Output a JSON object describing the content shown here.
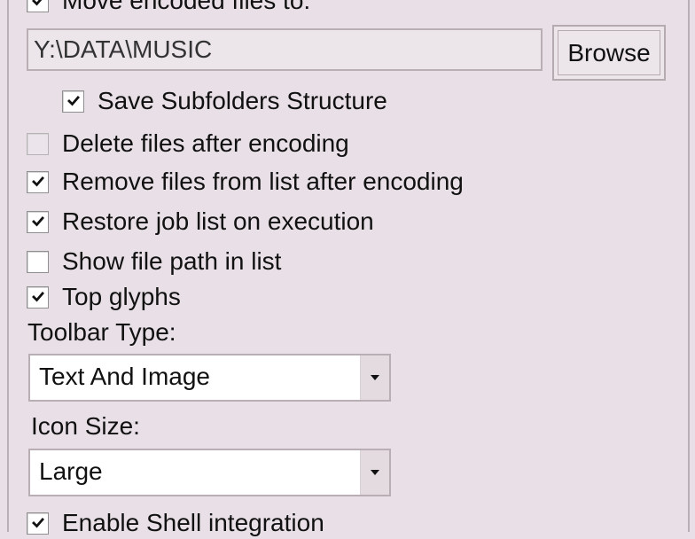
{
  "options": {
    "move_encoded_label": "Move encoded files to:",
    "move_encoded_path": "Y:\\DATA\\MUSIC",
    "browse_label": "Browse",
    "save_subfolders_label": "Save Subfolders Structure",
    "delete_files_label": "Delete files after encoding",
    "remove_files_label": "Remove files from list after encoding",
    "restore_job_list_label": "Restore job list on execution",
    "show_file_path_label": "Show file path in list",
    "top_glyphs_label": "Top glyphs",
    "toolbar_type_label": "Toolbar Type:",
    "toolbar_type_value": "Text And Image",
    "icon_size_label": "Icon Size:",
    "icon_size_value": "Large",
    "enable_shell_label": "Enable Shell integration"
  },
  "states": {
    "move_encoded_checked": true,
    "save_subfolders_checked": true,
    "delete_files_checked": false,
    "remove_files_checked": true,
    "restore_job_list_checked": true,
    "show_file_path_checked": false,
    "top_glyphs_checked": true,
    "enable_shell_checked": true
  },
  "colors": {
    "background": "#e8e0e6",
    "input_background": "#ece6eb",
    "select_background": "#ffffff"
  },
  "icons": {
    "checkbox_check": "check-icon",
    "dropdown_arrow": "chevron-down-icon"
  }
}
